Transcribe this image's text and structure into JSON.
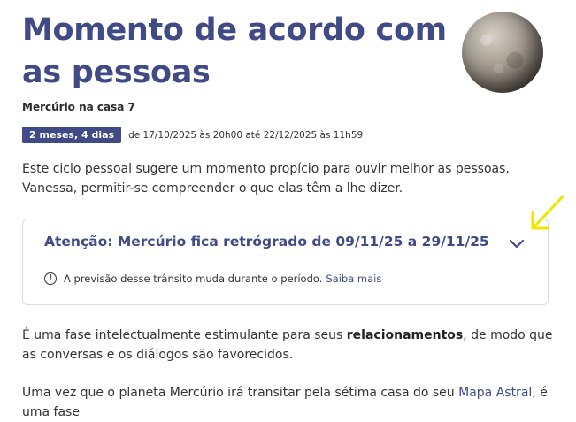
{
  "header": {
    "title": "Momento de acordo com as pessoas",
    "subtitle": "Mercúrio na casa 7"
  },
  "transit": {
    "duration_badge": "2 meses, 4 dias",
    "date_range": "de 17/10/2025 às 20h00 até 22/12/2025 às 11h59"
  },
  "intro": "Este ciclo pessoal sugere um momento propício para ouvir melhor as pessoas, Vanessa, permitir-se compreender o que elas têm a lhe dizer.",
  "alert_card": {
    "title": "Atenção: Mercúrio fica retrógrado de 09/11/25 a 29/11/25",
    "notice_text": "A previsão desse trânsito muda durante o período.",
    "notice_link": "Saiba mais",
    "info_symbol": "!",
    "icons": [
      "info-icon",
      "chevron-down-icon"
    ]
  },
  "body": {
    "p2_before": "É uma fase intelectualmente estimulante para seus ",
    "p2_bold": "relacionamentos",
    "p2_after": ", de modo que as conversas e os diálogos são favorecidos.",
    "p3_before": "Uma vez que o planeta Mercúrio irá transitar pela sétima casa do seu ",
    "p3_link": "Mapa Astral",
    "p3_after": ", é uma fase"
  },
  "colors": {
    "brand": "#3f4a86",
    "annotation_arrow": "#f2e600"
  }
}
